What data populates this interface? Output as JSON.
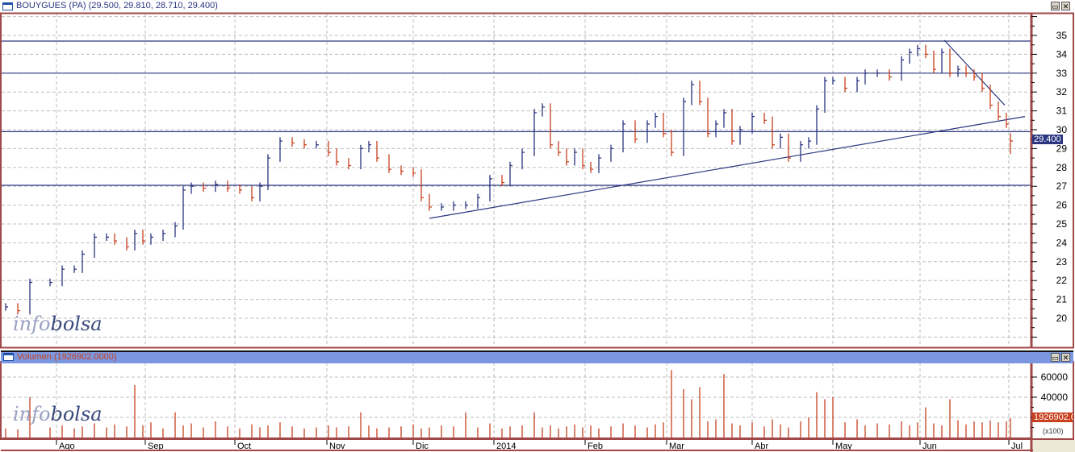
{
  "window": {
    "title": "BOUYGUES (PA) (29.500, 29.810, 28.710, 29.400)",
    "btn_max": "▭",
    "btn_close": "✕"
  },
  "volume_panel": {
    "title": "Volumen (1926902.0000)",
    "current_badge": "1926902.0",
    "unit": "(x100)"
  },
  "price_panel": {
    "current_badge": "29.400"
  },
  "logo": {
    "part1": "info",
    "part2": "bolsa"
  },
  "colors": {
    "up": "#2b3580",
    "down": "#c8401e",
    "frame": "#a04848",
    "grid": "#bdbdbd",
    "line": "#2b3580"
  },
  "chart_data": [
    {
      "type": "ohlc",
      "title": "BOUYGUES (PA)",
      "last": {
        "open": 29.5,
        "high": 29.81,
        "low": 28.71,
        "close": 29.4
      },
      "ylim": [
        19,
        36
      ],
      "yticks": [
        20,
        21,
        22,
        23,
        24,
        25,
        26,
        27,
        28,
        29,
        30,
        31,
        32,
        33,
        34,
        35
      ],
      "xlim_days": [
        0,
        255
      ],
      "month_ticks": [
        {
          "label": "Ago",
          "day": 13.6
        },
        {
          "label": "Sep",
          "day": 35.6
        },
        {
          "label": "Oct",
          "day": 57.8
        },
        {
          "label": "Nov",
          "day": 80.6
        },
        {
          "label": "Dic",
          "day": 102
        },
        {
          "label": "2014",
          "day": 122
        },
        {
          "label": "Feb",
          "day": 144.6
        },
        {
          "label": "Mar",
          "day": 164.8
        },
        {
          "label": "Abr",
          "day": 186
        },
        {
          "label": "May",
          "day": 206
        },
        {
          "label": "Jun",
          "day": 227.6
        },
        {
          "label": "Jul",
          "day": 249.6
        }
      ],
      "days": [
        1,
        4,
        7,
        12,
        15,
        18,
        20,
        23,
        26,
        28,
        31,
        33,
        35,
        37,
        40,
        43,
        45,
        47,
        50,
        53,
        56,
        59,
        62,
        64,
        66,
        69,
        72,
        75,
        78,
        81,
        83,
        86,
        89,
        91,
        93,
        96,
        99,
        102,
        104,
        106,
        109,
        112,
        115,
        118,
        121,
        124,
        126,
        129,
        132,
        134,
        136,
        138,
        140,
        142,
        144,
        146,
        148,
        151,
        154,
        157,
        160,
        162,
        164,
        166,
        169,
        171,
        173,
        175,
        177,
        179,
        181,
        183,
        186,
        189,
        191,
        193,
        195,
        198,
        200,
        202,
        204,
        206,
        209,
        212,
        214,
        217,
        220,
        223,
        225,
        227,
        229,
        231,
        233,
        235,
        237,
        239,
        241,
        243,
        245,
        247,
        249,
        250
      ],
      "closes": [
        20.6,
        20.4,
        21.9,
        21.9,
        22.6,
        22.6,
        23.4,
        24.3,
        24.3,
        24.1,
        23.8,
        24.5,
        24.1,
        24.3,
        24.5,
        24.9,
        26.8,
        27.0,
        26.9,
        27.1,
        26.9,
        26.8,
        26.4,
        27.0,
        28.5,
        29.4,
        29.3,
        29.2,
        29.2,
        28.8,
        28.3,
        28.1,
        29.0,
        29.2,
        28.5,
        27.9,
        27.8,
        27.7,
        26.4,
        25.9,
        25.9,
        26.0,
        26.0,
        26.4,
        27.4,
        27.2,
        28.1,
        28.8,
        30.9,
        31.2,
        29.2,
        28.8,
        28.3,
        28.8,
        28.1,
        27.9,
        28.5,
        29.0,
        30.3,
        29.5,
        30.3,
        30.7,
        29.8,
        28.8,
        31.5,
        32.4,
        31.5,
        29.8,
        30.3,
        30.9,
        29.4,
        30.0,
        30.7,
        30.5,
        29.2,
        29.6,
        28.5,
        29.2,
        29.4,
        31.1,
        32.6,
        32.6,
        32.2,
        32.6,
        33.0,
        33.0,
        32.8,
        33.7,
        34.1,
        34.3,
        34.0,
        33.2,
        34.1,
        33.0,
        33.2,
        33.0,
        32.8,
        32.2,
        31.3,
        30.7,
        30.3,
        29.4
      ],
      "hlines": [
        34.7,
        33.0,
        29.9,
        27.05
      ],
      "trendlines": [
        {
          "from": [
            106,
            25.3
          ],
          "to": [
            253.6,
            30.7
          ]
        },
        {
          "from": [
            233.6,
            34.75
          ],
          "to": [
            248.6,
            31.3
          ]
        }
      ]
    },
    {
      "type": "bar",
      "title": "Volumen",
      "unit": "x100",
      "ylim": [
        0,
        70000
      ],
      "yticks": [
        {
          "value": 40000,
          "label": "40000"
        },
        {
          "value": 60000,
          "label": "60000"
        }
      ],
      "grid": [
        20000,
        40000,
        60000
      ],
      "values": [
        9000,
        8000,
        40000,
        10000,
        12000,
        9000,
        11000,
        14000,
        10000,
        13000,
        11000,
        52000,
        12000,
        15000,
        9000,
        25000,
        12000,
        14000,
        10000,
        16000,
        11000,
        9000,
        13000,
        10000,
        12000,
        15000,
        11000,
        9000,
        10000,
        12000,
        10000,
        11000,
        25000,
        12000,
        9000,
        10000,
        11000,
        13000,
        9000,
        10000,
        12000,
        11000,
        25000,
        10000,
        14000,
        9000,
        11000,
        12000,
        25000,
        10000,
        12000,
        9000,
        11000,
        13000,
        10000,
        12000,
        9000,
        11000,
        14000,
        12000,
        10000,
        13000,
        15000,
        67000,
        48000,
        38000,
        50000,
        16000,
        18000,
        63000,
        14000,
        12000,
        15000,
        11000,
        18000,
        13000,
        10000,
        16000,
        20000,
        45000,
        38000,
        40000,
        15000,
        18000,
        12000,
        14000,
        13000,
        16000,
        12000,
        15000,
        30000,
        14000,
        12000,
        38000,
        17000,
        13000,
        16000,
        15000,
        17000,
        15000,
        16000,
        19269
      ]
    }
  ]
}
